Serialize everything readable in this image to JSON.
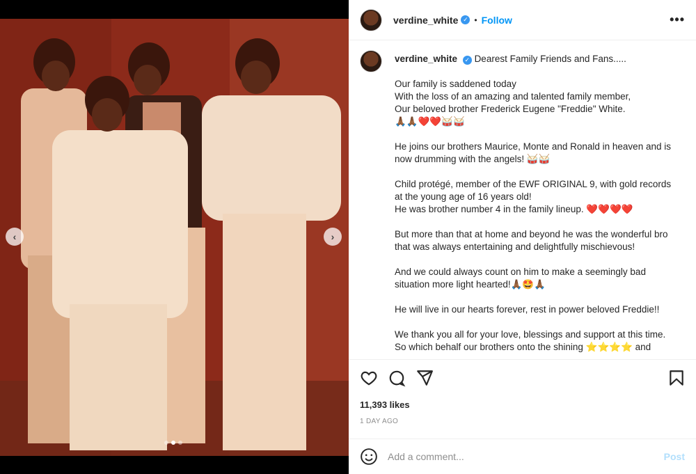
{
  "post": {
    "username": "verdine_white",
    "follow_label": "Follow",
    "separator": "•",
    "more_label": "•••"
  },
  "caption": {
    "username": "verdine_white",
    "lines": [
      "Dearest Family Friends and Fans.....",
      "Our family is saddened today\nWith the loss of an amazing and talented family member,\nOur beloved brother Frederick Eugene \"Freddie\" White.\n🙏🏾🙏🏾❤️❤️🥁🥁",
      "He joins our brothers Maurice, Monte and Ronald in heaven and is now drumming with the angels! 🥁🥁",
      "Child protégé, member of the EWF ORIGINAL 9, with gold records at the young age of 16 years old!\nHe was brother number 4 in the family lineup. ❤️❤️❤️❤️",
      "But more than that at home and beyond he was the wonderful bro that was always entertaining and delightfully mischievous!",
      "And we could always count on him to make a seemingly bad situation more light hearted!🙏🏾🤩🙏🏾",
      "He will live in our hearts forever, rest in power beloved Freddie!!",
      "We thank you all for your love, blessings and support at this time.",
      "So which behalf our brothers onto the shining ⭐⭐⭐⭐ and"
    ]
  },
  "stats": {
    "likes": "11,393 likes",
    "time": "1 DAY AGO"
  },
  "comment": {
    "placeholder": "Add a comment...",
    "post_label": "Post"
  },
  "carousel": {
    "prev": "‹",
    "next": "›",
    "slides": 3,
    "active_index": 1
  },
  "colors": {
    "accent": "#0095f6",
    "verified": "#3897f0",
    "post_disabled": "#b2dffc"
  }
}
